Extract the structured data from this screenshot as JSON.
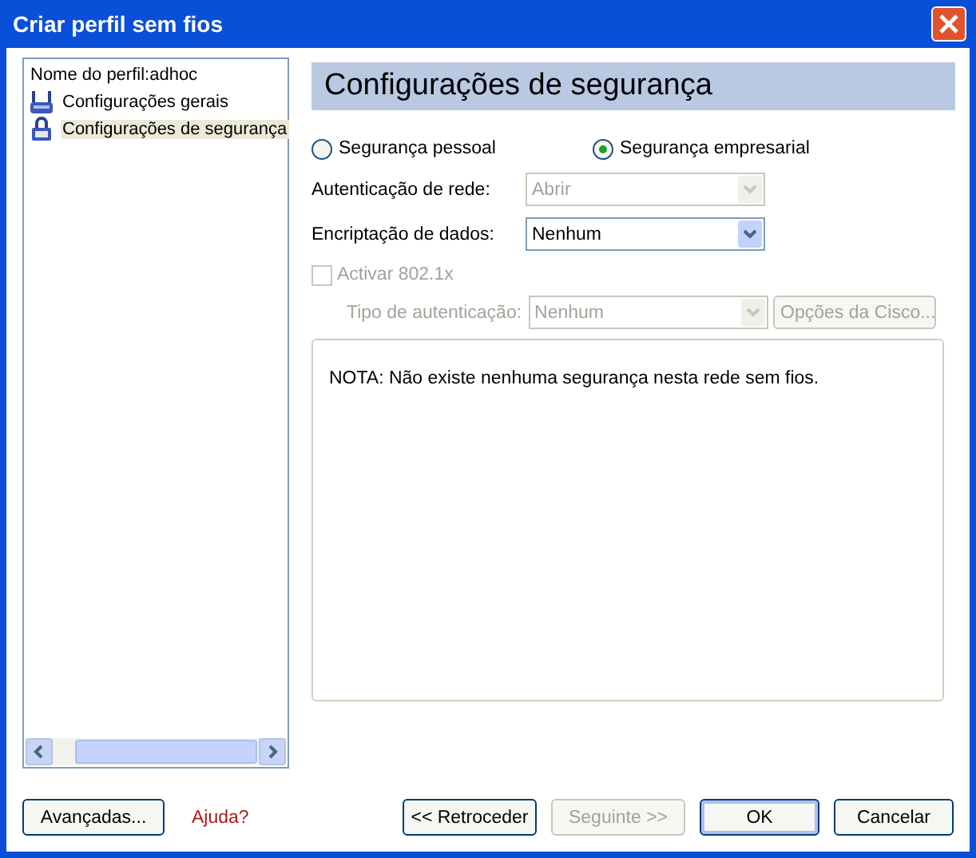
{
  "window": {
    "title": "Criar perfil sem fios"
  },
  "tree": {
    "items": [
      {
        "kind": "text",
        "label": "Nome do perfil:adhoc",
        "selected": false
      },
      {
        "kind": "general",
        "label": "Configurações gerais",
        "selected": false
      },
      {
        "kind": "security",
        "label": "Configurações de segurança",
        "selected": true
      }
    ]
  },
  "panel": {
    "title": "Configurações de segurança",
    "security_modes": [
      {
        "label": "Segurança pessoal",
        "selected": false
      },
      {
        "label": "Segurança empresarial",
        "selected": true
      }
    ],
    "fields": [
      {
        "label": "Autenticação de rede:",
        "value": "Abrir",
        "disabled": true
      },
      {
        "label": "Encriptação de dados:",
        "value": "Nenhum",
        "disabled": false
      }
    ],
    "enable_8021x": {
      "label": "Activar 802.1x",
      "checked": false,
      "disabled": true
    },
    "auth_type": {
      "label": "Tipo de autenticação:",
      "value": "Nenhum",
      "disabled": true
    },
    "cisco_button": {
      "label": "Opções da Cisco...",
      "disabled": true
    },
    "note": "NOTA: Não existe nenhuma segurança nesta rede sem fios."
  },
  "footer": {
    "advanced_button": {
      "label": "Avançadas...",
      "disabled": false
    },
    "help_link": "Ajuda?",
    "buttons": [
      {
        "label": "<< Retroceder",
        "disabled": false,
        "default": false
      },
      {
        "label": "Seguinte >>",
        "disabled": true,
        "default": false
      },
      {
        "label": "OK",
        "disabled": false,
        "default": true
      },
      {
        "label": "Cancelar",
        "disabled": false,
        "default": false
      }
    ]
  }
}
